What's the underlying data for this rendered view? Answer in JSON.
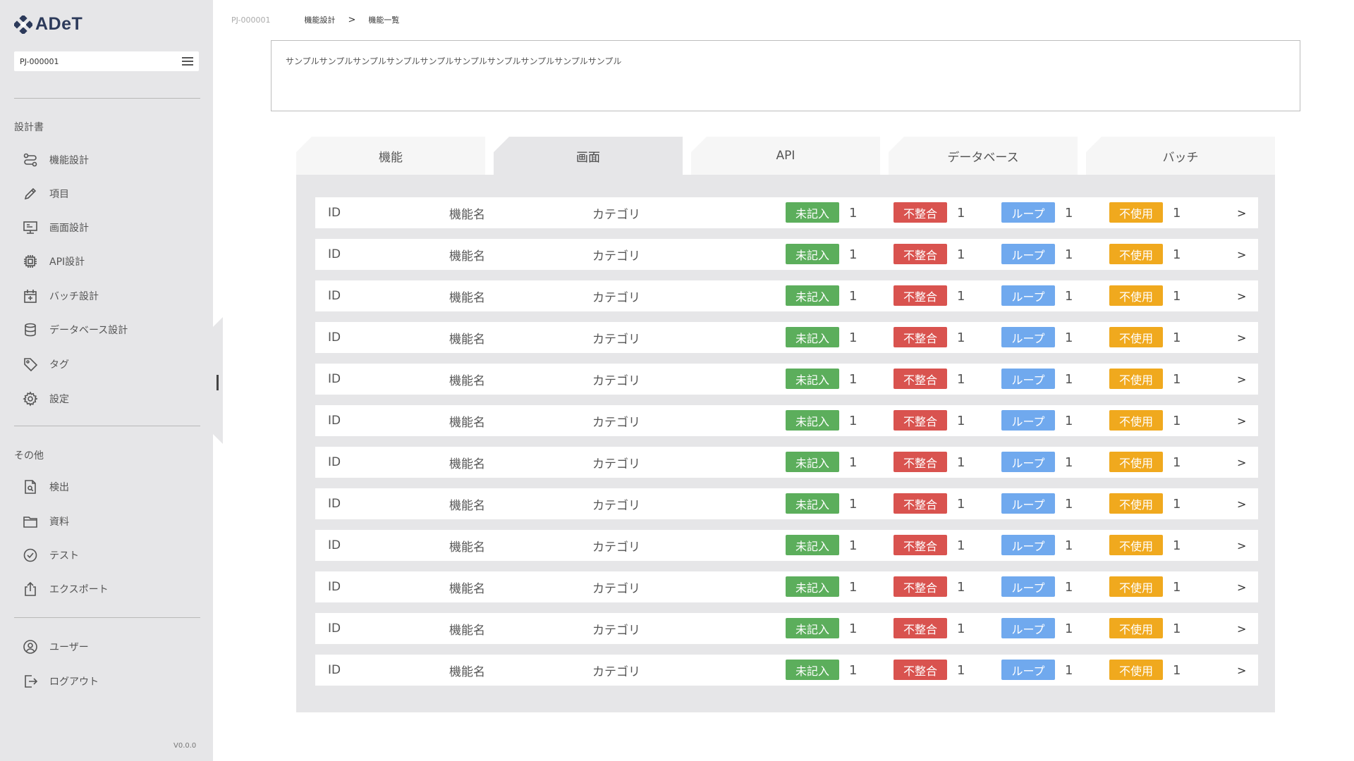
{
  "app": {
    "name": "ADeT",
    "version": "V0.0.0"
  },
  "project": {
    "id": "PJ-000001"
  },
  "sidebar": {
    "sections": [
      {
        "title": "設計書",
        "items": [
          {
            "label": "機能設計",
            "icon": "flow-icon"
          },
          {
            "label": "項目",
            "icon": "pencil-icon"
          },
          {
            "label": "画面設計",
            "icon": "monitor-icon"
          },
          {
            "label": "API設計",
            "icon": "chip-icon"
          },
          {
            "label": "バッチ設計",
            "icon": "calendar-icon"
          },
          {
            "label": "データベース設計",
            "icon": "database-icon"
          },
          {
            "label": "タグ",
            "icon": "tag-icon"
          },
          {
            "label": "設定",
            "icon": "gear-icon"
          }
        ]
      },
      {
        "title": "その他",
        "items": [
          {
            "label": "検出",
            "icon": "file-search-icon"
          },
          {
            "label": "資料",
            "icon": "folder-icon"
          },
          {
            "label": "テスト",
            "icon": "check-circle-icon"
          },
          {
            "label": "エクスポート",
            "icon": "export-icon"
          }
        ]
      },
      {
        "title": "",
        "items": [
          {
            "label": "ユーザー",
            "icon": "user-icon"
          },
          {
            "label": "ログアウト",
            "icon": "logout-icon"
          }
        ]
      }
    ]
  },
  "breadcrumb": {
    "project": "PJ-000001",
    "parent": "機能設計",
    "separator": ">",
    "current": "機能一覧"
  },
  "description": "サンプルサンプルサンプルサンプルサンプルサンプルサンプルサンプルサンプルサンプル",
  "tabs": [
    {
      "label": "機能",
      "active": false
    },
    {
      "label": "画面",
      "active": true
    },
    {
      "label": "API",
      "active": false
    },
    {
      "label": "データベース",
      "active": false
    },
    {
      "label": "バッチ",
      "active": false
    }
  ],
  "badges": [
    {
      "label": "未記入",
      "color": "#5cae5c"
    },
    {
      "label": "不整合",
      "color": "#d9534f"
    },
    {
      "label": "ループ",
      "color": "#70a9ee"
    },
    {
      "label": "不使用",
      "color": "#f0a91e"
    }
  ],
  "rows": [
    {
      "id": "ID",
      "name": "機能名",
      "category": "カテゴリ",
      "counts": [
        "1",
        "1",
        "1",
        "1"
      ],
      "arrow": ">"
    },
    {
      "id": "ID",
      "name": "機能名",
      "category": "カテゴリ",
      "counts": [
        "1",
        "1",
        "1",
        "1"
      ],
      "arrow": ">"
    },
    {
      "id": "ID",
      "name": "機能名",
      "category": "カテゴリ",
      "counts": [
        "1",
        "1",
        "1",
        "1"
      ],
      "arrow": ">"
    },
    {
      "id": "ID",
      "name": "機能名",
      "category": "カテゴリ",
      "counts": [
        "1",
        "1",
        "1",
        "1"
      ],
      "arrow": ">"
    },
    {
      "id": "ID",
      "name": "機能名",
      "category": "カテゴリ",
      "counts": [
        "1",
        "1",
        "1",
        "1"
      ],
      "arrow": ">"
    },
    {
      "id": "ID",
      "name": "機能名",
      "category": "カテゴリ",
      "counts": [
        "1",
        "1",
        "1",
        "1"
      ],
      "arrow": ">"
    },
    {
      "id": "ID",
      "name": "機能名",
      "category": "カテゴリ",
      "counts": [
        "1",
        "1",
        "1",
        "1"
      ],
      "arrow": ">"
    },
    {
      "id": "ID",
      "name": "機能名",
      "category": "カテゴリ",
      "counts": [
        "1",
        "1",
        "1",
        "1"
      ],
      "arrow": ">"
    },
    {
      "id": "ID",
      "name": "機能名",
      "category": "カテゴリ",
      "counts": [
        "1",
        "1",
        "1",
        "1"
      ],
      "arrow": ">"
    },
    {
      "id": "ID",
      "name": "機能名",
      "category": "カテゴリ",
      "counts": [
        "1",
        "1",
        "1",
        "1"
      ],
      "arrow": ">"
    },
    {
      "id": "ID",
      "name": "機能名",
      "category": "カテゴリ",
      "counts": [
        "1",
        "1",
        "1",
        "1"
      ],
      "arrow": ">"
    },
    {
      "id": "ID",
      "name": "機能名",
      "category": "カテゴリ",
      "counts": [
        "1",
        "1",
        "1",
        "1"
      ],
      "arrow": ">"
    }
  ]
}
